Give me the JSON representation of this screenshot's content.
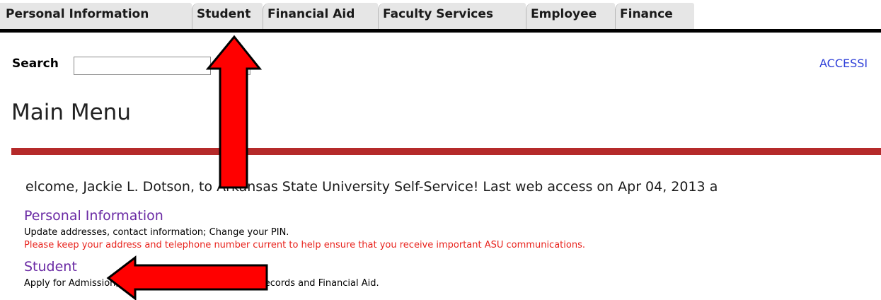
{
  "tabs": [
    {
      "label": "Personal Information"
    },
    {
      "label": "Student"
    },
    {
      "label": "Financial Aid"
    },
    {
      "label": "Faculty Services"
    },
    {
      "label": "Employee"
    },
    {
      "label": "Finance"
    }
  ],
  "search": {
    "label": "Search",
    "value": "",
    "go_label": ""
  },
  "access_link": "ACCESSI",
  "page_title": "Main Menu",
  "welcome": "elcome, Jackie L. Dotson, to Arkansas State University Self-Service! Last web access on Apr 04, 2013 a",
  "menu": [
    {
      "link": "Personal Information",
      "desc": "Update addresses, contact information; Change your PIN.",
      "warning": "Please keep your address and telephone number current to help ensure that you receive important ASU communications."
    },
    {
      "link": "Student",
      "desc": "Apply for Admission, Register, View your academic records and Financial Aid."
    }
  ],
  "colors": {
    "accent_red": "#b52a2a",
    "link_purple": "#6a2aa4",
    "warning_red": "#e8231d",
    "arrow_red": "#ff0000"
  }
}
